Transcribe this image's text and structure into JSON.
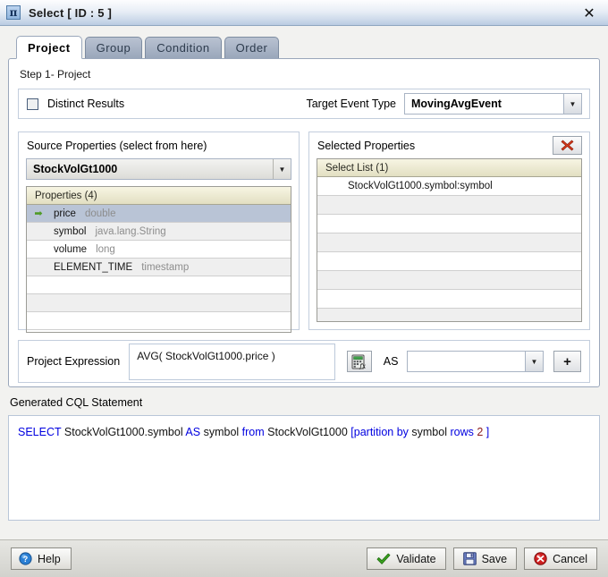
{
  "window": {
    "title": "Select [ ID : 5 ]",
    "icon": "pi-icon",
    "close_label": "✕"
  },
  "tabs": [
    {
      "label": "Project",
      "active": true
    },
    {
      "label": "Group",
      "active": false
    },
    {
      "label": "Condition",
      "active": false
    },
    {
      "label": "Order",
      "active": false
    }
  ],
  "step": {
    "label": "Step 1- Project"
  },
  "options": {
    "distinct_label": "Distinct Results",
    "distinct_checked": false,
    "target_event_type_label": "Target Event Type",
    "target_event_type_value": "MovingAvgEvent"
  },
  "source_properties": {
    "title": "Source Properties (select from here)",
    "stream_value": "StockVolGt1000",
    "list_header": "Properties (4)",
    "rows": [
      {
        "name": "price",
        "type": "double",
        "selected": true
      },
      {
        "name": "symbol",
        "type": "java.lang.String",
        "selected": false
      },
      {
        "name": "volume",
        "type": "long",
        "selected": false
      },
      {
        "name": "ELEMENT_TIME",
        "type": "timestamp",
        "selected": false
      },
      {
        "name": "",
        "type": "",
        "selected": false
      },
      {
        "name": "",
        "type": "",
        "selected": false
      },
      {
        "name": "",
        "type": "",
        "selected": false
      }
    ]
  },
  "selected_properties": {
    "title": "Selected Properties",
    "delete_icon": "red-x-icon",
    "list_header": "Select List (1)",
    "rows": [
      {
        "text": "StockVolGt1000.symbol:symbol"
      },
      {
        "text": ""
      },
      {
        "text": ""
      },
      {
        "text": ""
      },
      {
        "text": ""
      },
      {
        "text": ""
      },
      {
        "text": ""
      },
      {
        "text": ""
      }
    ]
  },
  "project_expression": {
    "label": "Project Expression",
    "value": "AVG( StockVolGt1000.price )",
    "editor_icon": "calculator-fx-icon",
    "as_label": "AS",
    "as_value": "",
    "add_label": "+"
  },
  "cql": {
    "label": "Generated CQL Statement",
    "tokens": [
      {
        "t": "SELECT",
        "k": "kw"
      },
      {
        "t": "StockVolGt1000.symbol",
        "k": "plain"
      },
      {
        "t": "AS",
        "k": "kw"
      },
      {
        "t": "symbol",
        "k": "plain"
      },
      {
        "t": "from",
        "k": "kw"
      },
      {
        "t": "StockVolGt1000",
        "k": "plain"
      },
      {
        "t": "[partition by",
        "k": "kw"
      },
      {
        "t": "symbol",
        "k": "plain"
      },
      {
        "t": "rows",
        "k": "kw"
      },
      {
        "t": "2",
        "k": "num"
      },
      {
        "t": "]",
        "k": "kw"
      }
    ],
    "statement": "SELECT StockVolGt1000.symbol AS symbol from  StockVolGt1000  [partition by  symbol  rows 2 ]"
  },
  "footer": {
    "help": "Help",
    "validate": "Validate",
    "save": "Save",
    "cancel": "Cancel"
  },
  "colors": {
    "accent_blue": "#0000e0",
    "number_red": "#8a1a1a",
    "selection": "#b9c4d6",
    "list_header": "#e2dfc2"
  }
}
